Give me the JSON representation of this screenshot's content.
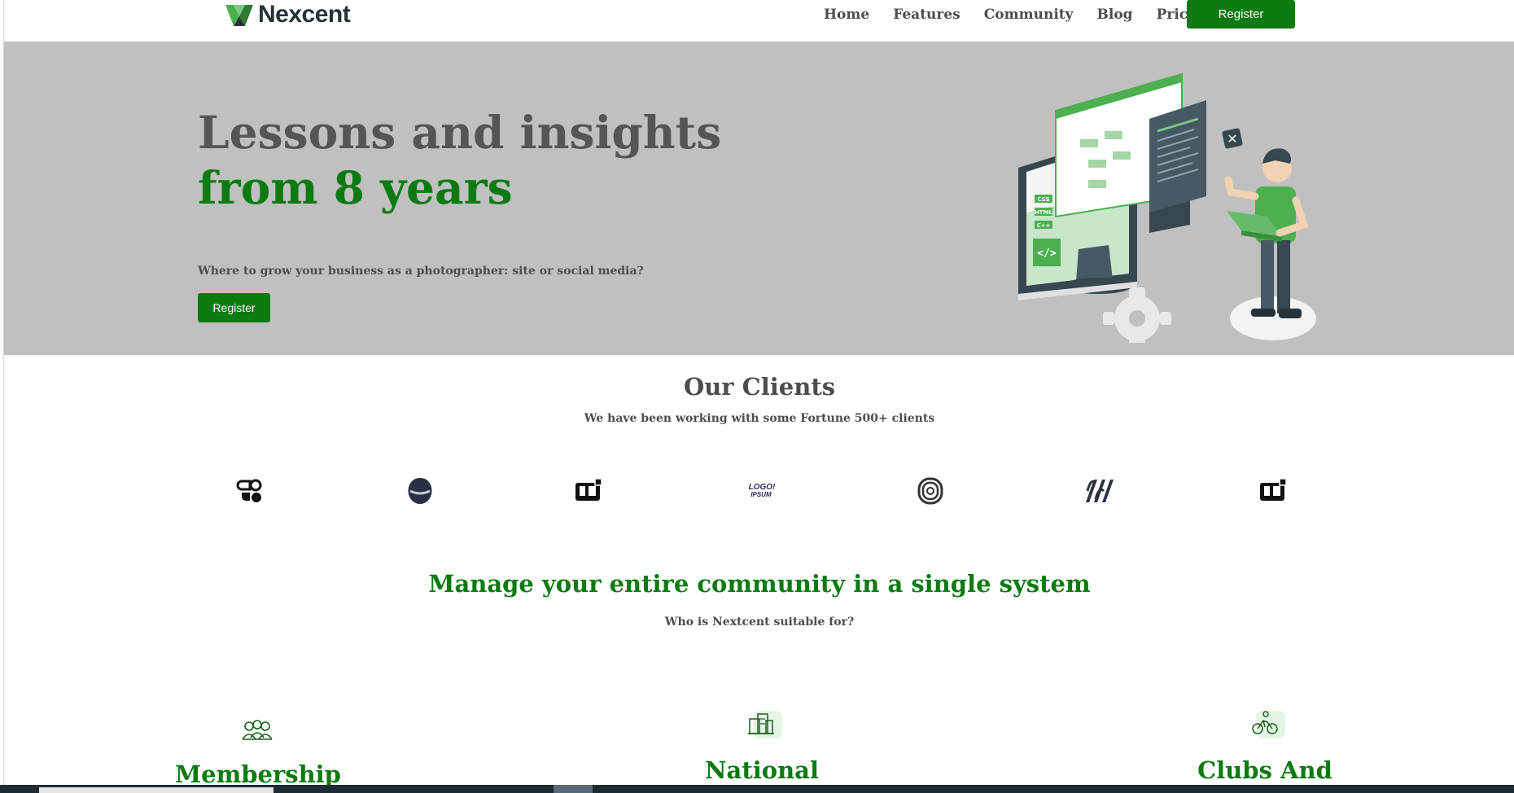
{
  "nav": {
    "brand": "Nexcent",
    "links": [
      "Home",
      "Features",
      "Community",
      "Blog",
      "Pricing"
    ],
    "register_label": "Register"
  },
  "hero": {
    "title_line1": "Lessons and insights",
    "title_line2": "from 8 years",
    "subtitle": "Where to grow your business as a photographer: site or social media?",
    "button_label": "Register",
    "illustration_labels": [
      "CSS",
      "HTML",
      "C++"
    ]
  },
  "clients": {
    "title": "Our Clients",
    "subtitle": "We have been working with some Fortune 500+ clients",
    "logos": [
      "client-logo-1",
      "client-logo-2",
      "client-logo-3",
      "client-logo-4",
      "client-logo-5",
      "client-logo-6",
      "client-logo-7"
    ],
    "logo_ipsum_text": "LOGO IPSUM"
  },
  "manage": {
    "title": "Manage your entire community in a single system",
    "subtitle": "Who is Nextcent suitable for?",
    "cards": [
      {
        "title": "Membership",
        "icon": "users-icon"
      },
      {
        "title": "National",
        "icon": "building-icon"
      },
      {
        "title": "Clubs And",
        "icon": "cyclist-icon"
      }
    ]
  },
  "colors": {
    "brand_green": "#0a7a11",
    "hero_bg": "#c0c0c0",
    "text_gray": "#4d4d4d",
    "dark": "#263238"
  }
}
